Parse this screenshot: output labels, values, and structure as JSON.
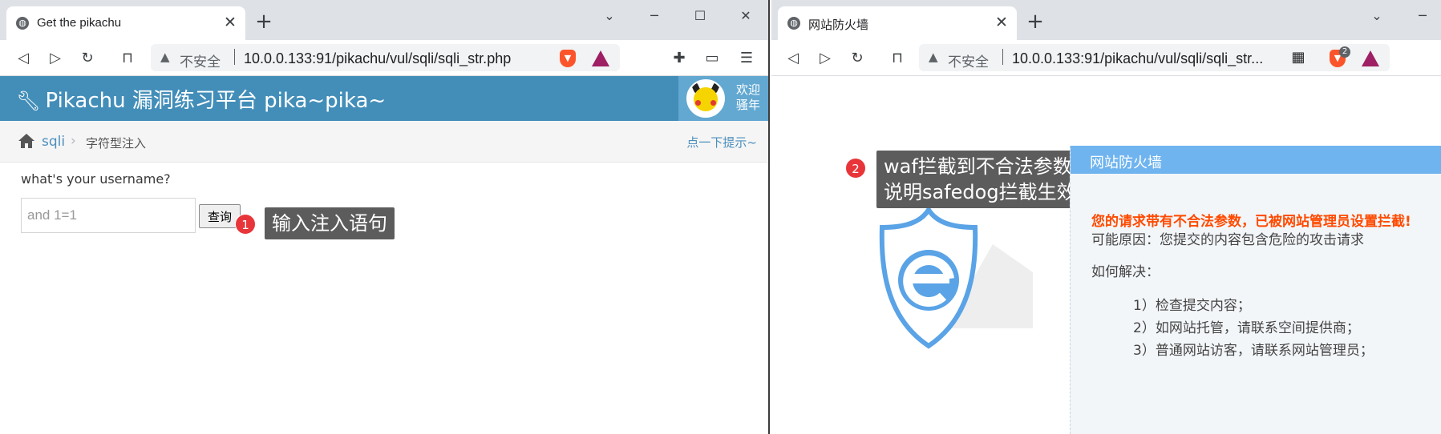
{
  "left_window": {
    "tab": {
      "title": "Get the pikachu",
      "close": "✕"
    },
    "new_tab": "+",
    "window_controls": {
      "dropdown": "⌄",
      "minimize": "─",
      "maximize": "☐",
      "close": "✕"
    },
    "address": {
      "security_label": "不安全",
      "url": "10.0.0.133:91/pikachu/vul/sqli/sqli_str.php"
    },
    "page": {
      "logo_text": "Pikachu 漏洞练习平台 pika~pika~",
      "welcome": "欢迎",
      "welcome_user": "骚年",
      "breadcrumb": {
        "section": "sqli",
        "current": "字符型注入",
        "hint": "点一下提示~"
      },
      "question": "what's your username?",
      "username_value": "and 1=1",
      "submit_label": "查询"
    },
    "callout": {
      "number": "1",
      "text": "输入注入语句"
    }
  },
  "right_window": {
    "tab": {
      "title": "网站防火墙",
      "close": "✕"
    },
    "new_tab": "+",
    "window_controls": {
      "dropdown": "⌄",
      "minimize": "─"
    },
    "address": {
      "security_label": "不安全",
      "url": "10.0.0.133:91/pikachu/vul/sqli/sqli_str..."
    },
    "brave_badge": "2",
    "callout": {
      "number": "2",
      "line1": "waf拦截到不合法参数",
      "line2": "说明safedog拦截生效"
    },
    "waf": {
      "title": "网站防火墙",
      "message": "您的请求带有不合法参数，已被网站管理员设置拦截!",
      "reason": "可能原因：您提交的内容包含危险的攻击请求",
      "how_to": "如何解决：",
      "steps": [
        "1）检查提交内容；",
        "2）如网站托管，请联系空间提供商；",
        "3）普通网站访客，请联系网站管理员；"
      ]
    }
  },
  "colors": {
    "pikachu_header": "#438eb9",
    "waf_title_bar": "#6fb4ef",
    "waf_warning": "#ff4a00",
    "callout_badge": "#e8353a"
  },
  "icons": [
    "globe-icon",
    "back-icon",
    "forward-icon",
    "reload-icon",
    "bookmark-icon",
    "warning-icon",
    "brave-shields-icon",
    "bat-rewards-icon",
    "extensions-icon",
    "wallet-icon",
    "menu-icon",
    "wrench-icon",
    "home-icon",
    "qr-icon",
    "shield-e-icon"
  ]
}
